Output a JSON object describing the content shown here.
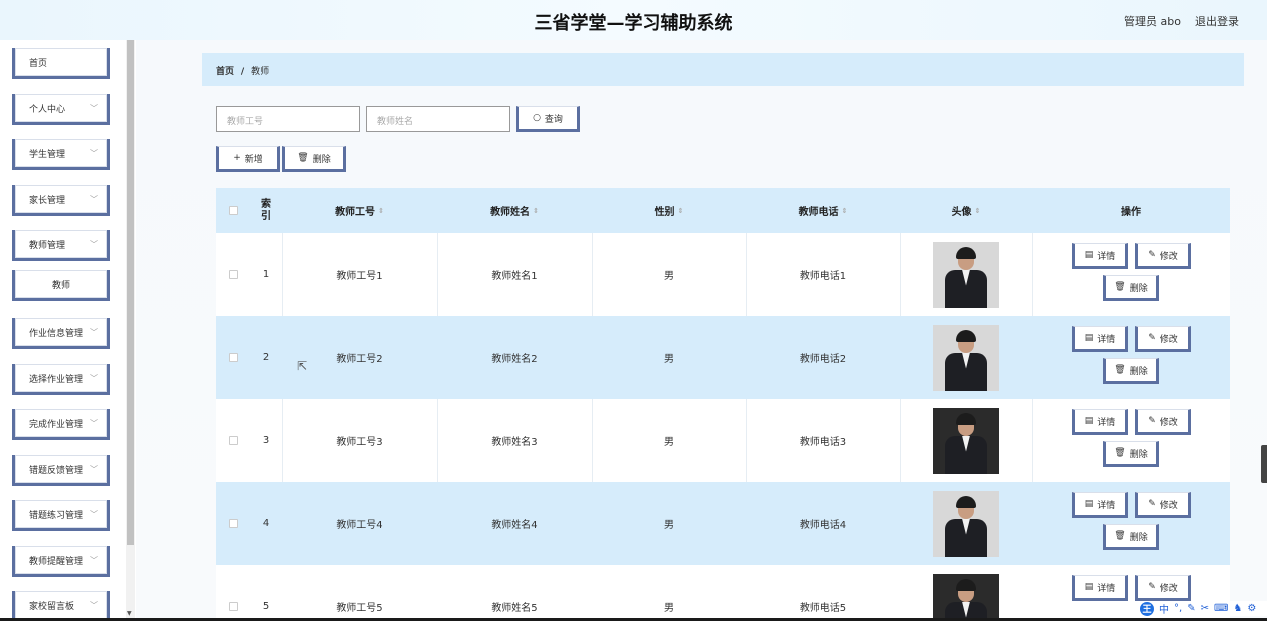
{
  "header": {
    "title": "三省学堂—学习辅助系统",
    "user_label": "管理员 abo",
    "logout_label": "退出登录"
  },
  "sidebar": {
    "items": [
      {
        "label": "首页",
        "has_arrow": false
      },
      {
        "label": "个人中心",
        "has_arrow": true
      },
      {
        "label": "学生管理",
        "has_arrow": true
      },
      {
        "label": "家长管理",
        "has_arrow": true
      },
      {
        "label": "教师管理",
        "has_arrow": true
      },
      {
        "label": "教师",
        "has_arrow": false,
        "sub": true
      },
      {
        "label": "作业信息管理",
        "has_arrow": true
      },
      {
        "label": "选择作业管理",
        "has_arrow": true
      },
      {
        "label": "完成作业管理",
        "has_arrow": true
      },
      {
        "label": "错题反馈管理",
        "has_arrow": true
      },
      {
        "label": "错题练习管理",
        "has_arrow": true
      },
      {
        "label": "教师提醒管理",
        "has_arrow": true
      },
      {
        "label": "家校留言板",
        "has_arrow": true
      }
    ]
  },
  "breadcrumb": {
    "home": "首页",
    "separator": "/",
    "current": "教师"
  },
  "search": {
    "teacher_id_placeholder": "教师工号",
    "teacher_name_placeholder": "教师姓名",
    "query_label": "查询"
  },
  "toolbar": {
    "add_label": "新增",
    "delete_label": "删除"
  },
  "table": {
    "headers": [
      "索引",
      "教师工号",
      "教师姓名",
      "性别",
      "教师电话",
      "头像",
      "操作"
    ],
    "index_header_line1": "索",
    "index_header_line2": "引",
    "rows": [
      {
        "index": "1",
        "teacher_id": "教师工号1",
        "teacher_name": "教师姓名1",
        "gender": "男",
        "phone": "教师电话1"
      },
      {
        "index": "2",
        "teacher_id": "教师工号2",
        "teacher_name": "教师姓名2",
        "gender": "男",
        "phone": "教师电话2"
      },
      {
        "index": "3",
        "teacher_id": "教师工号3",
        "teacher_name": "教师姓名3",
        "gender": "男",
        "phone": "教师电话3"
      },
      {
        "index": "4",
        "teacher_id": "教师工号4",
        "teacher_name": "教师姓名4",
        "gender": "男",
        "phone": "教师电话4"
      },
      {
        "index": "5",
        "teacher_id": "教师工号5",
        "teacher_name": "教师姓名5",
        "gender": "男",
        "phone": "教师电话5"
      }
    ],
    "actions": {
      "detail": "详情",
      "edit": "修改",
      "delete": "删除"
    }
  },
  "ime": {
    "logo": "王",
    "mode": "中"
  },
  "colors": {
    "accent": "#5b6fa0",
    "row_highlight": "#d6ecfb",
    "header_bg": "#eaf6fd"
  }
}
